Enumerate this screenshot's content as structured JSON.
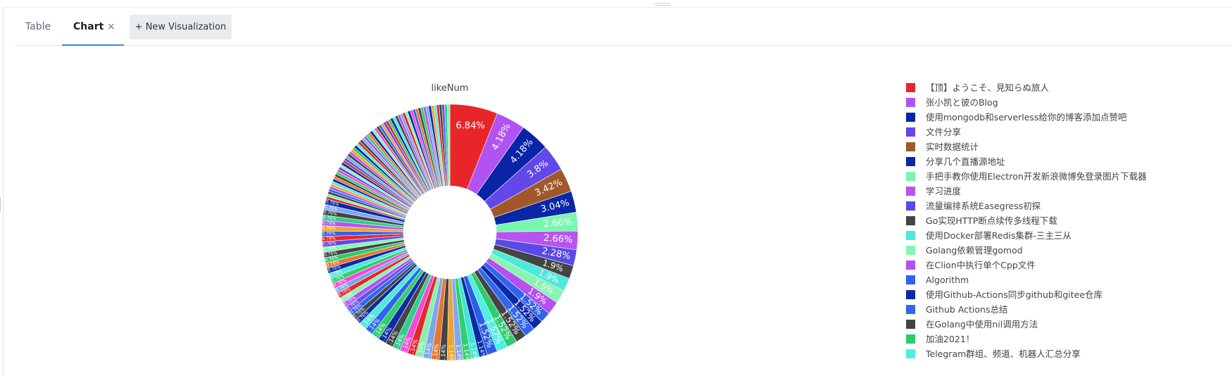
{
  "tabs": {
    "table_label": "Table",
    "chart_label": "Chart",
    "close_glyph": "×",
    "new_visualization_label": "+ New Visualization"
  },
  "chart_data": {
    "type": "pie",
    "donut": true,
    "title": "likeNum",
    "unit": "%",
    "legend_position": "right",
    "slices": [
      {
        "label": "【顶】ようこそ、見知らぬ旅人",
        "value": 6.84,
        "color": "#e8262a"
      },
      {
        "label": "张小凯と彼のBlog",
        "value": 4.18,
        "color": "#b153f2"
      },
      {
        "label": "使用mongodb和serverless给你的博客添加点赞吧",
        "value": 4.18,
        "color": "#0a24a8"
      },
      {
        "label": "文件分享",
        "value": 3.8,
        "color": "#6248e8"
      },
      {
        "label": "实时数据统计",
        "value": 3.42,
        "color": "#a0582b"
      },
      {
        "label": "分享几个直播源地址",
        "value": 3.04,
        "color": "#0a28a6"
      },
      {
        "label": "手把手教你使用Electron开发新浪微博免登录图片下载器",
        "value": 2.66,
        "color": "#7af5b0"
      },
      {
        "label": "学习进度",
        "value": 2.66,
        "color": "#b655ee"
      },
      {
        "label": "流量编排系统Easegress初探",
        "value": 2.28,
        "color": "#5b49e6"
      },
      {
        "label": "Go实现HTTP断点续传多线程下载",
        "value": 1.9,
        "color": "#444444"
      },
      {
        "label": "使用Docker部署Redis集群-三主三从",
        "value": 1.9,
        "color": "#4ee8dc"
      },
      {
        "label": "Golang依赖管理gomod",
        "value": 1.9,
        "color": "#86f5b2"
      },
      {
        "label": "在Clion中执行单个Cpp文件",
        "value": 1.9,
        "color": "#b54ff0"
      },
      {
        "label": "Algorithm",
        "value": 1.52,
        "color": "#2f63ef"
      },
      {
        "label": "使用Github-Actions同步github和gitee仓库",
        "value": 1.52,
        "color": "#0c2aa3"
      },
      {
        "label": "Github Actions总结",
        "value": 1.52,
        "color": "#2f67f0"
      },
      {
        "label": "在Golang中使用nil调用方法",
        "value": 1.52,
        "color": "#444444"
      },
      {
        "label": "加油2021！",
        "value": 1.52,
        "color": "#2fcb6c"
      },
      {
        "label": "Telegram群组、频道、机器人汇总分享",
        "value": 1.52,
        "color": "#4ef0e3"
      },
      {
        "label": "",
        "value": 1.52,
        "color": "#2b5ee8"
      },
      {
        "label": "",
        "value": 1.14,
        "color": "#0b2ba6"
      },
      {
        "label": "",
        "value": 1.14,
        "color": "#3ee6d6"
      },
      {
        "label": "",
        "value": 1.14,
        "color": "#2fcf6a"
      },
      {
        "label": "",
        "value": 1.14,
        "color": "#7fa9ef"
      },
      {
        "label": "",
        "value": 1.14,
        "color": "#f0a230"
      },
      {
        "label": "",
        "value": 1.14,
        "color": "#444444"
      },
      {
        "label": "",
        "value": 1.14,
        "color": "#e8752e"
      },
      {
        "label": "",
        "value": 1.14,
        "color": "#7aa6ee"
      },
      {
        "label": "",
        "value": 1.14,
        "color": "#87f0ac"
      },
      {
        "label": "",
        "value": 1.14,
        "color": "#e6262e"
      },
      {
        "label": "",
        "value": 1.14,
        "color": "#f04bd3"
      },
      {
        "label": "",
        "value": 1.14,
        "color": "#2fcf8a"
      },
      {
        "label": "",
        "value": 1.14,
        "color": "#444444"
      },
      {
        "label": "",
        "value": 1.14,
        "color": "#0c2ba8"
      },
      {
        "label": "",
        "value": 1.14,
        "color": "#2fcf6a"
      },
      {
        "label": "",
        "value": 1.14,
        "color": "#2f66ee"
      },
      {
        "label": "",
        "value": 1.14,
        "color": "#4ee8dc"
      },
      {
        "label": "",
        "value": 0.76,
        "color": "#0b2aa6"
      },
      {
        "label": "",
        "value": 0.76,
        "color": "#444444"
      },
      {
        "label": "",
        "value": 0.76,
        "color": "#2f66ee"
      },
      {
        "label": "",
        "value": 0.76,
        "color": "#6b50e6"
      },
      {
        "label": "",
        "value": 0.76,
        "color": "#b153f2"
      },
      {
        "label": "",
        "value": 0.76,
        "color": "#86f5b2"
      },
      {
        "label": "",
        "value": 0.76,
        "color": "#e8262a"
      },
      {
        "label": "",
        "value": 0.76,
        "color": "#7aa6ee"
      },
      {
        "label": "",
        "value": 0.76,
        "color": "#f04bd3"
      },
      {
        "label": "",
        "value": 0.76,
        "color": "#2fcf6a"
      },
      {
        "label": "",
        "value": 0.76,
        "color": "#4ee8dc"
      },
      {
        "label": "",
        "value": 0.76,
        "color": "#0c2aa3"
      },
      {
        "label": "",
        "value": 0.76,
        "color": "#e8752e"
      },
      {
        "label": "",
        "value": 0.76,
        "color": "#2fcb6c"
      },
      {
        "label": "",
        "value": 0.76,
        "color": "#444444"
      },
      {
        "label": "",
        "value": 0.76,
        "color": "#86f5b2"
      },
      {
        "label": "",
        "value": 0.76,
        "color": "#6248e8"
      },
      {
        "label": "",
        "value": 0.76,
        "color": "#e8262a"
      },
      {
        "label": "",
        "value": 0.76,
        "color": "#2f63ef"
      },
      {
        "label": "",
        "value": 0.76,
        "color": "#f0a230"
      },
      {
        "label": "",
        "value": 0.76,
        "color": "#b655ee"
      },
      {
        "label": "",
        "value": 0.76,
        "color": "#2fcf8a"
      },
      {
        "label": "",
        "value": 0.76,
        "color": "#444444"
      },
      {
        "label": "",
        "value": 0.76,
        "color": "#7fa9ef"
      },
      {
        "label": "",
        "value": 0.76,
        "color": "#0a28a6"
      },
      {
        "label": "",
        "value": 0.38,
        "color": "#e8262a"
      },
      {
        "label": "",
        "value": 0.38,
        "color": "#7af5b0"
      },
      {
        "label": "",
        "value": 0.38,
        "color": "#444444"
      },
      {
        "label": "",
        "value": 0.38,
        "color": "#2f66ee"
      },
      {
        "label": "",
        "value": 0.38,
        "color": "#b153f2"
      },
      {
        "label": "",
        "value": 0.38,
        "color": "#f0a230"
      },
      {
        "label": "",
        "value": 0.38,
        "color": "#4ee8dc"
      },
      {
        "label": "",
        "value": 0.38,
        "color": "#0c2aa3"
      },
      {
        "label": "",
        "value": 0.38,
        "color": "#e8752e"
      },
      {
        "label": "",
        "value": 0.38,
        "color": "#444444"
      },
      {
        "label": "",
        "value": 0.38,
        "color": "#2fcf6a"
      },
      {
        "label": "",
        "value": 0.38,
        "color": "#f04bd3"
      },
      {
        "label": "",
        "value": 0.38,
        "color": "#6b50e6"
      },
      {
        "label": "",
        "value": 0.38,
        "color": "#86f5b2"
      },
      {
        "label": "",
        "value": 0.38,
        "color": "#0b2ba6"
      },
      {
        "label": "",
        "value": 0.38,
        "color": "#e6262e"
      },
      {
        "label": "",
        "value": 0.38,
        "color": "#2f63ef"
      },
      {
        "label": "",
        "value": 0.38,
        "color": "#7aa6ee"
      },
      {
        "label": "",
        "value": 0.38,
        "color": "#444444"
      },
      {
        "label": "",
        "value": 0.38,
        "color": "#b655ee"
      },
      {
        "label": "",
        "value": 0.38,
        "color": "#f0a230"
      },
      {
        "label": "",
        "value": 0.38,
        "color": "#2fcb6c"
      },
      {
        "label": "",
        "value": 0.38,
        "color": "#0a24a8"
      },
      {
        "label": "",
        "value": 0.38,
        "color": "#4ef0e3"
      },
      {
        "label": "",
        "value": 0.38,
        "color": "#e8262a"
      },
      {
        "label": "",
        "value": 0.38,
        "color": "#444444"
      },
      {
        "label": "",
        "value": 0.38,
        "color": "#7fa9ef"
      },
      {
        "label": "",
        "value": 0.38,
        "color": "#b153f2"
      },
      {
        "label": "",
        "value": 0.38,
        "color": "#2fcf8a"
      },
      {
        "label": "",
        "value": 0.38,
        "color": "#e8752e"
      },
      {
        "label": "",
        "value": 0.38,
        "color": "#0c2ba8"
      },
      {
        "label": "",
        "value": 0.38,
        "color": "#86f5b2"
      },
      {
        "label": "",
        "value": 0.38,
        "color": "#f04bd3"
      },
      {
        "label": "",
        "value": 0.38,
        "color": "#444444"
      },
      {
        "label": "",
        "value": 0.38,
        "color": "#2f66ee"
      },
      {
        "label": "",
        "value": 0.38,
        "color": "#f0a230"
      },
      {
        "label": "",
        "value": 0.38,
        "color": "#6248e8"
      },
      {
        "label": "",
        "value": 0.38,
        "color": "#e8262a"
      },
      {
        "label": "",
        "value": 0.38,
        "color": "#2fcf6a"
      },
      {
        "label": "",
        "value": 0.38,
        "color": "#0a28a6"
      },
      {
        "label": "",
        "value": 0.38,
        "color": "#4ee8dc"
      },
      {
        "label": "",
        "value": 0.38,
        "color": "#444444"
      },
      {
        "label": "",
        "value": 0.38,
        "color": "#b655ee"
      },
      {
        "label": "",
        "value": 0.38,
        "color": "#7aa6ee"
      },
      {
        "label": "",
        "value": 0.38,
        "color": "#e6262e"
      },
      {
        "label": "",
        "value": 0.38,
        "color": "#86f5b2"
      },
      {
        "label": "",
        "value": 0.38,
        "color": "#0b2aa6"
      },
      {
        "label": "",
        "value": 0.38,
        "color": "#f04bd3"
      },
      {
        "label": "",
        "value": 0.38,
        "color": "#2f63ef"
      },
      {
        "label": "",
        "value": 0.38,
        "color": "#e8752e"
      },
      {
        "label": "",
        "value": 0.38,
        "color": "#444444"
      },
      {
        "label": "",
        "value": 0.38,
        "color": "#2fcb6c"
      },
      {
        "label": "",
        "value": 0.38,
        "color": "#b153f2"
      },
      {
        "label": "",
        "value": 0.38,
        "color": "#7fa9ef"
      },
      {
        "label": "",
        "value": 0.38,
        "color": "#0c2aa3"
      },
      {
        "label": "",
        "value": 0.38,
        "color": "#f0a230"
      },
      {
        "label": "",
        "value": 0.38,
        "color": "#4ef0e3"
      },
      {
        "label": "",
        "value": 0.38,
        "color": "#e8262a"
      },
      {
        "label": "",
        "value": 0.38,
        "color": "#444444"
      },
      {
        "label": "",
        "value": 0.38,
        "color": "#6b50e6"
      },
      {
        "label": "",
        "value": 0.38,
        "color": "#2fcf8a"
      },
      {
        "label": "",
        "value": 0.38,
        "color": "#86f5b2"
      }
    ]
  }
}
